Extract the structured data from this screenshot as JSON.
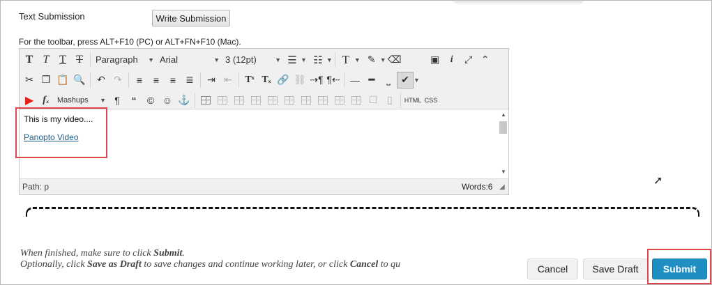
{
  "text_submission": {
    "label": "Text Submission",
    "write_button": "Write Submission"
  },
  "toolbar_hint": "For the toolbar, press ALT+F10 (PC) or ALT+FN+F10 (Mac).",
  "toolbar": {
    "paragraph": "Paragraph",
    "font_family": "Arial",
    "font_size": "3 (12pt)",
    "mashups": "Mashups",
    "html_label": "HTML",
    "css_label": "CSS"
  },
  "editor": {
    "line1": "This is my video....",
    "link": "Panopto Video",
    "path": "Path: p",
    "words": "Words:6"
  },
  "instructions": {
    "line1_pre": "When finished, make sure to click ",
    "line1_bold": "Submit",
    "line1_post": ".",
    "line2_pre": "Optionally, click ",
    "line2_bold1": "Save as Draft",
    "line2_mid": " to save changes and continue working later, or click ",
    "line2_bold2": "Cancel",
    "line2_post": " to qu"
  },
  "buttons": {
    "cancel": "Cancel",
    "save_draft": "Save Draft",
    "submit": "Submit"
  },
  "colors": {
    "submit_bg": "#1f8ec3",
    "highlight": "#e0474c",
    "link": "#1b5f8a"
  }
}
